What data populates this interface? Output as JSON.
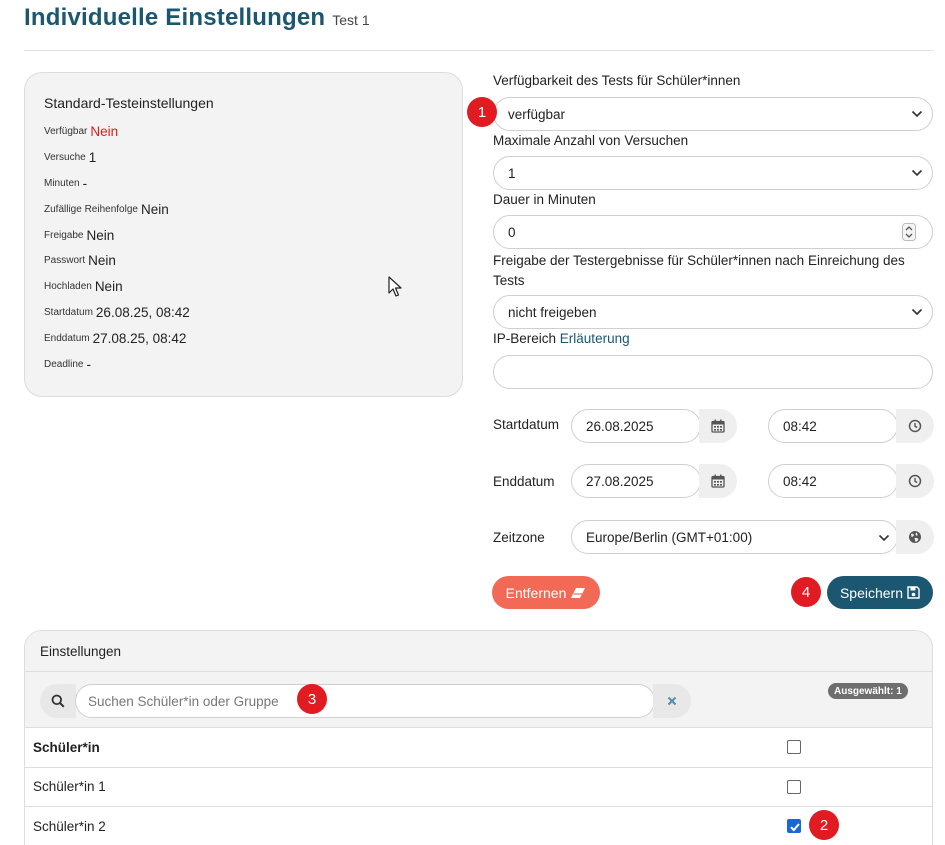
{
  "header": {
    "title": "Individuelle Einstellungen",
    "subtitle": "Test 1"
  },
  "standard": {
    "title": "Standard-Testeinstellungen",
    "rows": [
      {
        "label": "Verfügbar",
        "value": "Nein",
        "highlight": true
      },
      {
        "label": "Versuche",
        "value": "1"
      },
      {
        "label": "Minuten",
        "value": "-"
      },
      {
        "label": "Zufällige Reihenfolge",
        "value": "Nein"
      },
      {
        "label": "Freigabe",
        "value": "Nein"
      },
      {
        "label": "Passwort",
        "value": "Nein"
      },
      {
        "label": "Hochladen",
        "value": "Nein"
      },
      {
        "label": "Startdatum",
        "value": "26.08.25, 08:42"
      },
      {
        "label": "Enddatum",
        "value": "27.08.25, 08:42"
      },
      {
        "label": "Deadline",
        "value": "-"
      }
    ]
  },
  "form": {
    "availability_label": "Verfügbarkeit des Tests für Schüler*innen",
    "availability_value": "verfügbar",
    "attempts_label": "Maximale Anzahl von Versuchen",
    "attempts_value": "1",
    "duration_label": "Dauer in Minuten",
    "duration_value": "0",
    "release_label_line1": "Freigabe der Testergebnisse für Schüler*innen nach Einreichung des",
    "release_label_line2": "Tests",
    "release_value": "nicht freigeben",
    "ip_label": "IP-Bereich",
    "ip_link": "Erläuterung",
    "ip_value": "",
    "start_label": "Startdatum",
    "start_date": "26.08.2025",
    "start_time": "08:42",
    "end_label": "Enddatum",
    "end_date": "27.08.2025",
    "end_time": "08:42",
    "timezone_label": "Zeitzone",
    "timezone_value": "Europe/Berlin (GMT+01:00)",
    "remove_label": "Entfernen",
    "save_label": "Speichern"
  },
  "settings": {
    "title": "Einstellungen",
    "search_placeholder": "Suchen Schüler*in oder Gruppe",
    "selected_badge": "Ausgewählt: 1",
    "table": {
      "header": "Schüler*in",
      "rows": [
        {
          "name": "Schüler*in 1",
          "checked": false
        },
        {
          "name": "Schüler*in 2",
          "checked": true
        }
      ]
    }
  },
  "annotations": [
    "1",
    "2",
    "3",
    "4"
  ],
  "colors": {
    "brand": "#1b5770",
    "danger": "#f26a55",
    "marker": "#e11b22",
    "highlight": "#e21b1b",
    "check": "#1769d3"
  }
}
